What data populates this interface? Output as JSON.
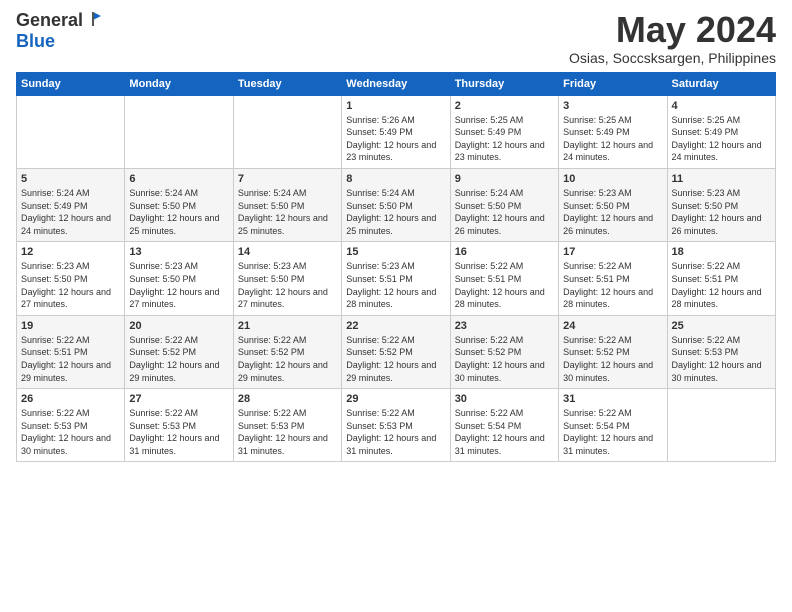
{
  "logo": {
    "general": "General",
    "blue": "Blue"
  },
  "header": {
    "month": "May 2024",
    "location": "Osias, Soccsksargen, Philippines"
  },
  "weekdays": [
    "Sunday",
    "Monday",
    "Tuesday",
    "Wednesday",
    "Thursday",
    "Friday",
    "Saturday"
  ],
  "weeks": [
    [
      {
        "day": "",
        "sunrise": "",
        "sunset": "",
        "daylight": ""
      },
      {
        "day": "",
        "sunrise": "",
        "sunset": "",
        "daylight": ""
      },
      {
        "day": "",
        "sunrise": "",
        "sunset": "",
        "daylight": ""
      },
      {
        "day": "1",
        "sunrise": "Sunrise: 5:26 AM",
        "sunset": "Sunset: 5:49 PM",
        "daylight": "Daylight: 12 hours and 23 minutes."
      },
      {
        "day": "2",
        "sunrise": "Sunrise: 5:25 AM",
        "sunset": "Sunset: 5:49 PM",
        "daylight": "Daylight: 12 hours and 23 minutes."
      },
      {
        "day": "3",
        "sunrise": "Sunrise: 5:25 AM",
        "sunset": "Sunset: 5:49 PM",
        "daylight": "Daylight: 12 hours and 24 minutes."
      },
      {
        "day": "4",
        "sunrise": "Sunrise: 5:25 AM",
        "sunset": "Sunset: 5:49 PM",
        "daylight": "Daylight: 12 hours and 24 minutes."
      }
    ],
    [
      {
        "day": "5",
        "sunrise": "Sunrise: 5:24 AM",
        "sunset": "Sunset: 5:49 PM",
        "daylight": "Daylight: 12 hours and 24 minutes."
      },
      {
        "day": "6",
        "sunrise": "Sunrise: 5:24 AM",
        "sunset": "Sunset: 5:50 PM",
        "daylight": "Daylight: 12 hours and 25 minutes."
      },
      {
        "day": "7",
        "sunrise": "Sunrise: 5:24 AM",
        "sunset": "Sunset: 5:50 PM",
        "daylight": "Daylight: 12 hours and 25 minutes."
      },
      {
        "day": "8",
        "sunrise": "Sunrise: 5:24 AM",
        "sunset": "Sunset: 5:50 PM",
        "daylight": "Daylight: 12 hours and 25 minutes."
      },
      {
        "day": "9",
        "sunrise": "Sunrise: 5:24 AM",
        "sunset": "Sunset: 5:50 PM",
        "daylight": "Daylight: 12 hours and 26 minutes."
      },
      {
        "day": "10",
        "sunrise": "Sunrise: 5:23 AM",
        "sunset": "Sunset: 5:50 PM",
        "daylight": "Daylight: 12 hours and 26 minutes."
      },
      {
        "day": "11",
        "sunrise": "Sunrise: 5:23 AM",
        "sunset": "Sunset: 5:50 PM",
        "daylight": "Daylight: 12 hours and 26 minutes."
      }
    ],
    [
      {
        "day": "12",
        "sunrise": "Sunrise: 5:23 AM",
        "sunset": "Sunset: 5:50 PM",
        "daylight": "Daylight: 12 hours and 27 minutes."
      },
      {
        "day": "13",
        "sunrise": "Sunrise: 5:23 AM",
        "sunset": "Sunset: 5:50 PM",
        "daylight": "Daylight: 12 hours and 27 minutes."
      },
      {
        "day": "14",
        "sunrise": "Sunrise: 5:23 AM",
        "sunset": "Sunset: 5:50 PM",
        "daylight": "Daylight: 12 hours and 27 minutes."
      },
      {
        "day": "15",
        "sunrise": "Sunrise: 5:23 AM",
        "sunset": "Sunset: 5:51 PM",
        "daylight": "Daylight: 12 hours and 28 minutes."
      },
      {
        "day": "16",
        "sunrise": "Sunrise: 5:22 AM",
        "sunset": "Sunset: 5:51 PM",
        "daylight": "Daylight: 12 hours and 28 minutes."
      },
      {
        "day": "17",
        "sunrise": "Sunrise: 5:22 AM",
        "sunset": "Sunset: 5:51 PM",
        "daylight": "Daylight: 12 hours and 28 minutes."
      },
      {
        "day": "18",
        "sunrise": "Sunrise: 5:22 AM",
        "sunset": "Sunset: 5:51 PM",
        "daylight": "Daylight: 12 hours and 28 minutes."
      }
    ],
    [
      {
        "day": "19",
        "sunrise": "Sunrise: 5:22 AM",
        "sunset": "Sunset: 5:51 PM",
        "daylight": "Daylight: 12 hours and 29 minutes."
      },
      {
        "day": "20",
        "sunrise": "Sunrise: 5:22 AM",
        "sunset": "Sunset: 5:52 PM",
        "daylight": "Daylight: 12 hours and 29 minutes."
      },
      {
        "day": "21",
        "sunrise": "Sunrise: 5:22 AM",
        "sunset": "Sunset: 5:52 PM",
        "daylight": "Daylight: 12 hours and 29 minutes."
      },
      {
        "day": "22",
        "sunrise": "Sunrise: 5:22 AM",
        "sunset": "Sunset: 5:52 PM",
        "daylight": "Daylight: 12 hours and 29 minutes."
      },
      {
        "day": "23",
        "sunrise": "Sunrise: 5:22 AM",
        "sunset": "Sunset: 5:52 PM",
        "daylight": "Daylight: 12 hours and 30 minutes."
      },
      {
        "day": "24",
        "sunrise": "Sunrise: 5:22 AM",
        "sunset": "Sunset: 5:52 PM",
        "daylight": "Daylight: 12 hours and 30 minutes."
      },
      {
        "day": "25",
        "sunrise": "Sunrise: 5:22 AM",
        "sunset": "Sunset: 5:53 PM",
        "daylight": "Daylight: 12 hours and 30 minutes."
      }
    ],
    [
      {
        "day": "26",
        "sunrise": "Sunrise: 5:22 AM",
        "sunset": "Sunset: 5:53 PM",
        "daylight": "Daylight: 12 hours and 30 minutes."
      },
      {
        "day": "27",
        "sunrise": "Sunrise: 5:22 AM",
        "sunset": "Sunset: 5:53 PM",
        "daylight": "Daylight: 12 hours and 31 minutes."
      },
      {
        "day": "28",
        "sunrise": "Sunrise: 5:22 AM",
        "sunset": "Sunset: 5:53 PM",
        "daylight": "Daylight: 12 hours and 31 minutes."
      },
      {
        "day": "29",
        "sunrise": "Sunrise: 5:22 AM",
        "sunset": "Sunset: 5:53 PM",
        "daylight": "Daylight: 12 hours and 31 minutes."
      },
      {
        "day": "30",
        "sunrise": "Sunrise: 5:22 AM",
        "sunset": "Sunset: 5:54 PM",
        "daylight": "Daylight: 12 hours and 31 minutes."
      },
      {
        "day": "31",
        "sunrise": "Sunrise: 5:22 AM",
        "sunset": "Sunset: 5:54 PM",
        "daylight": "Daylight: 12 hours and 31 minutes."
      },
      {
        "day": "",
        "sunrise": "",
        "sunset": "",
        "daylight": ""
      }
    ]
  ]
}
